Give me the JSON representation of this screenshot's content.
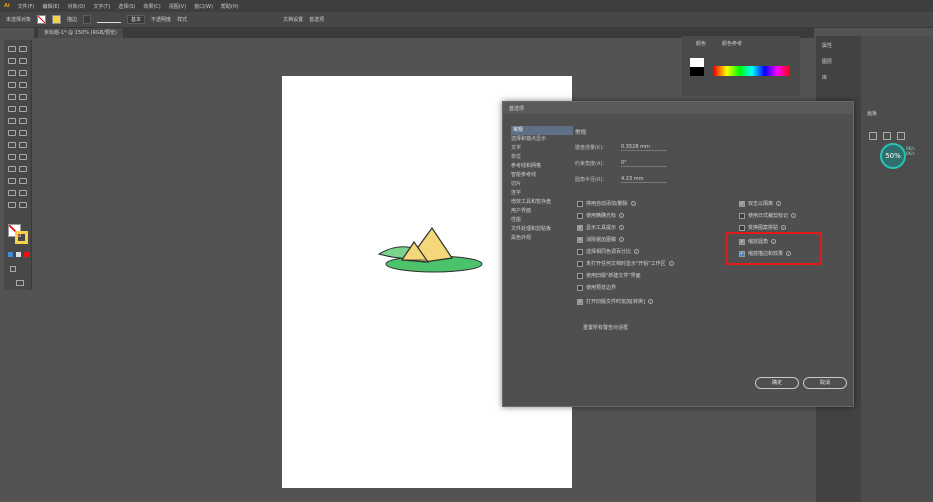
{
  "app": {
    "menu": [
      "Ai",
      "文件(F)",
      "编辑(E)",
      "对象(O)",
      "文字(T)",
      "选择(S)",
      "效果(C)",
      "视图(V)",
      "窗口(W)",
      "帮助(H)"
    ]
  },
  "options_bar": {
    "selection_label": "未选择对象",
    "stroke_label": "描边",
    "stroke_weight": "",
    "stroke_style": "基本",
    "opacity_label": "不透明度",
    "style_label": "样式",
    "doc_setup": "文档设置",
    "prefs": "首选项"
  },
  "document_tab": {
    "label": "未标题-1* @ 150% (RGB/预览)"
  },
  "right_panel": {
    "title": "颜色",
    "guide": "颜色参考",
    "props": "属性",
    "layers": "图层",
    "libraries": "库",
    "artboards": "画板"
  },
  "speed_widget": {
    "value": "50%",
    "line1": "0K/s",
    "line2": "0K/s"
  },
  "dialog": {
    "title": "首选项",
    "nav": [
      "常规",
      "选择和锚点显示",
      "文字",
      "单位",
      "参考线和网格",
      "智能参考线",
      "切片",
      "连字",
      "增效工具和暂存盘",
      "用户界面",
      "性能",
      "文件处理和剪贴板",
      "黑色外观"
    ],
    "section": "常规",
    "fields": [
      {
        "label": "键盘增量(K):",
        "value": "0.3528 mm"
      },
      {
        "label": "约束角度(A):",
        "value": "0°"
      },
      {
        "label": "圆角半径(R):",
        "value": "4.23 mm"
      }
    ],
    "left_checks": [
      {
        "label": "停用自动添加/删除",
        "checked": false
      },
      {
        "label": "使用精确光标",
        "checked": false
      },
      {
        "label": "显示工具提示",
        "checked": true
      },
      {
        "label": "消除锯齿图稿",
        "checked": true
      },
      {
        "label": "选择相同色调百分比",
        "checked": false
      },
      {
        "label": "未打开任何文档时显示\"开始\"工作区",
        "checked": false
      },
      {
        "label": "使用旧版\"新建文件\"界面",
        "checked": false
      },
      {
        "label": "使用预览边界",
        "checked": false
      },
      {
        "label": "打开旧版文件时追加[转换]",
        "checked": true
      }
    ],
    "right_checks": [
      {
        "label": "双击以隔离",
        "checked": true
      },
      {
        "label": "使用日式裁剪标记",
        "checked": false
      },
      {
        "label": "变换图案拼贴",
        "checked": false
      },
      {
        "label": "缩放圆角",
        "checked": true
      },
      {
        "label": "缩放描边和效果",
        "checked": true
      }
    ],
    "reset_label": "重置所有警告对话框",
    "ok": "确定",
    "cancel": "取消"
  },
  "colors": {
    "accent": "#e01b1b",
    "dialog_bg": "#4f4f4f",
    "workspace_bg": "#535353",
    "artboard": "#ffffff",
    "illustration_green": "#4cc36a",
    "illustration_yellow": "#f3d77a"
  }
}
